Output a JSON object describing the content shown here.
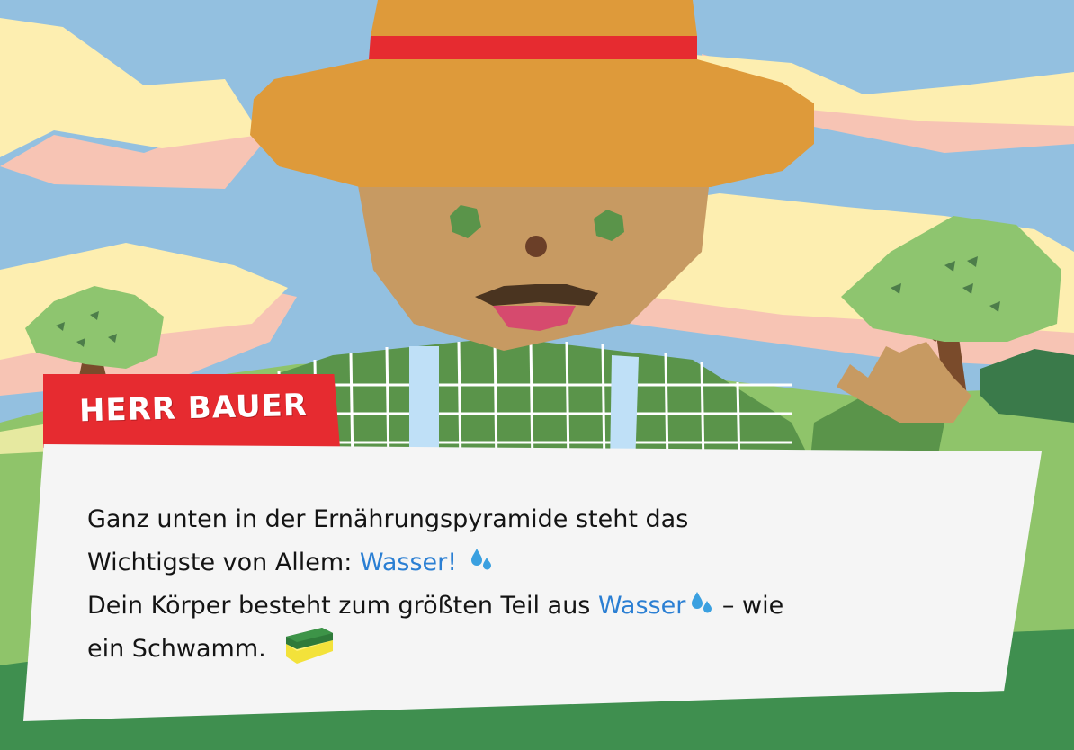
{
  "speaker": {
    "name": "HERR BAUER"
  },
  "dialog": {
    "line1": "Ganz unten in der Ernährungspyramide steht das",
    "line2_before": "Wichtigste von Allem: ",
    "line2_highlight": "Wasser!",
    "line3_before": "Dein Körper besteht zum größten Teil aus ",
    "line3_highlight": "Wasser",
    "line3_after": " – wie",
    "line4": "ein Schwamm."
  },
  "icons": {
    "water_drop": "water-drops-icon",
    "sponge": "sponge-icon"
  },
  "colors": {
    "sky": "#93c0e0",
    "name_tag": "#e62b30",
    "highlight": "#2b7fd3",
    "dialog_bg": "#f5f5f5"
  }
}
